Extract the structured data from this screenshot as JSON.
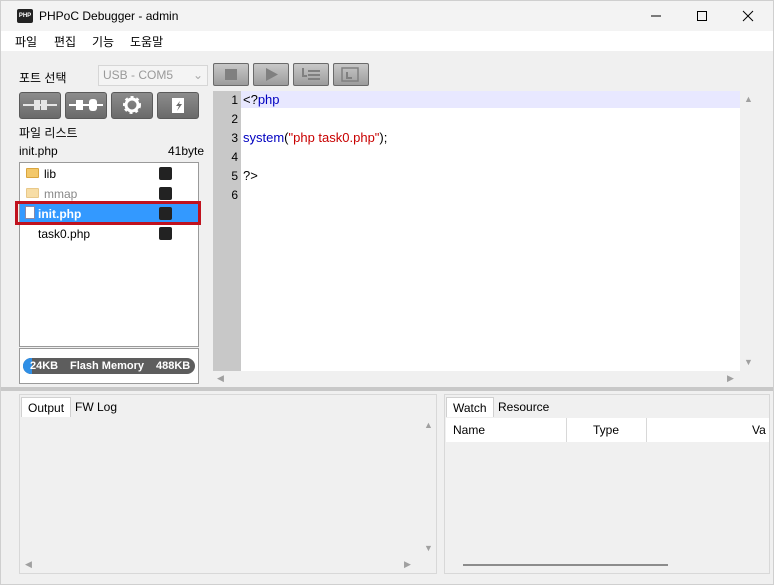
{
  "window": {
    "app_icon_text": "PHP",
    "title": "PHPoC Debugger - admin"
  },
  "menu": {
    "items": [
      "파일",
      "편집",
      "기능",
      "도움말"
    ]
  },
  "left": {
    "port_label": "포트 선택",
    "port_value": "USB - COM5",
    "list_label": "파일 리스트",
    "selected_file": "init.php",
    "selected_size": "41byte",
    "files": [
      {
        "name": "lib",
        "type": "folder",
        "dim": false
      },
      {
        "name": "mmap",
        "type": "folder",
        "dim": true
      },
      {
        "name": "init.php",
        "type": "file",
        "selected": true
      },
      {
        "name": "task0.php",
        "type": "file",
        "selected": false
      }
    ],
    "memory": {
      "used": "24KB",
      "label": "Flash Memory",
      "total": "488KB",
      "fill_fraction": 0.05
    }
  },
  "editor": {
    "line_numbers": [
      "1",
      "2",
      "3",
      "4",
      "5",
      "6"
    ],
    "lines": {
      "l1_open": "<?",
      "l1_php": "php",
      "l3_fn": "system",
      "l3_paren_open": "(",
      "l3_str": "\"php task0.php\"",
      "l3_close": ");",
      "l5": "?>"
    }
  },
  "output": {
    "tabs": [
      "Output",
      "FW Log"
    ]
  },
  "watch": {
    "tabs": [
      "Watch",
      "Resource"
    ],
    "columns": [
      "Name",
      "Type",
      "Va"
    ]
  },
  "colors": {
    "selection": "#3399ff",
    "highlight_border": "#c0121e",
    "keyword": "#0000c0",
    "string": "#c80000"
  }
}
